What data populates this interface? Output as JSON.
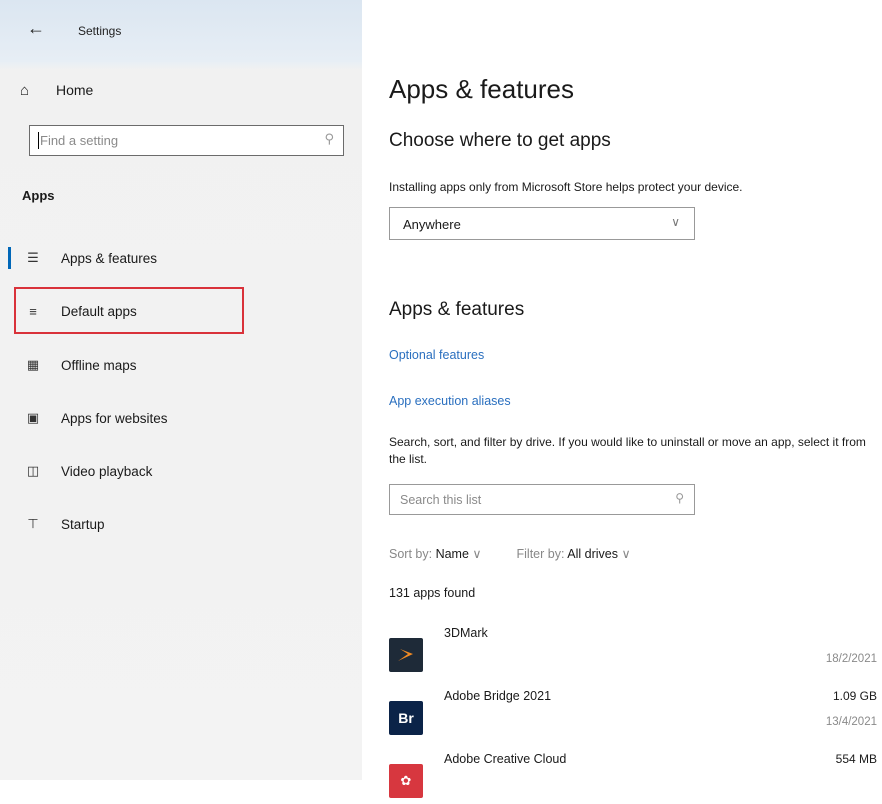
{
  "window": {
    "title": "Settings"
  },
  "sidebar": {
    "home_label": "Home",
    "search_placeholder": "Find a setting",
    "section": "Apps",
    "items": [
      {
        "label": "Apps & features",
        "icon": "list-icon",
        "active": true
      },
      {
        "label": "Default apps",
        "icon": "default-apps-icon",
        "highlighted": true
      },
      {
        "label": "Offline maps",
        "icon": "map-icon"
      },
      {
        "label": "Apps for websites",
        "icon": "web-app-icon"
      },
      {
        "label": "Video playback",
        "icon": "video-icon"
      },
      {
        "label": "Startup",
        "icon": "startup-icon"
      }
    ]
  },
  "main": {
    "title": "Apps & features",
    "choose_heading": "Choose where to get apps",
    "choose_desc": "Installing apps only from Microsoft Store helps protect your device.",
    "source_dropdown_value": "Anywhere",
    "section_heading": "Apps & features",
    "links": {
      "optional_features": "Optional features",
      "execution_aliases": "App execution aliases"
    },
    "search_desc": "Search, sort, and filter by drive. If you would like to uninstall or move an app, select it from the list.",
    "search_placeholder": "Search this list",
    "sort_prefix": "Sort by:",
    "sort_value": "Name",
    "filter_prefix": "Filter by:",
    "filter_value": "All drives",
    "apps_count": "131 apps found",
    "apps": [
      {
        "name": "3DMark",
        "size": "",
        "date": "18/2/2021",
        "icon_color": "#1e2a38"
      },
      {
        "name": "Adobe Bridge 2021",
        "size": "1.09 GB",
        "date": "13/4/2021",
        "icon_text": "Br",
        "icon_color": "#0b2348"
      },
      {
        "name": "Adobe Creative Cloud",
        "size": "554 MB",
        "date": "",
        "icon_color": "#d7373f"
      }
    ]
  },
  "colors": {
    "accent": "#0067b8",
    "link": "#2a6fbf",
    "highlight_box": "#d9323a"
  }
}
